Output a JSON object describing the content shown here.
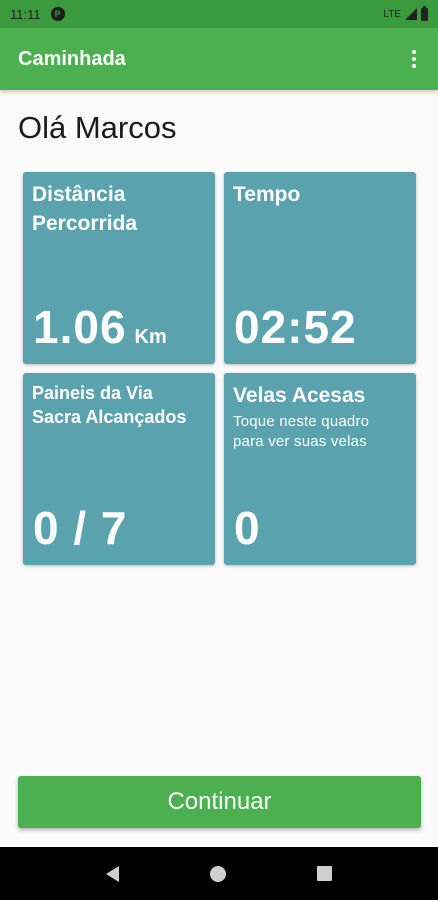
{
  "status_bar": {
    "time": "11:11",
    "app_icon_letter": "P",
    "network": "LTE"
  },
  "app_bar": {
    "title": "Caminhada"
  },
  "greeting": "Olá Marcos",
  "tiles": {
    "distance": {
      "title_line1": "Distância",
      "title_line2": "Percorrida",
      "value": "1.06",
      "unit": "Km"
    },
    "time": {
      "title": "Tempo",
      "value": "02:52"
    },
    "panels": {
      "title_line1": "Paineis da Via",
      "title_line2": "Sacra Alcançados",
      "value": "0 / 7"
    },
    "candles": {
      "title": "Velas Acesas",
      "subtitle_line1": "Toque neste quadro",
      "subtitle_line2": "para ver suas velas",
      "value": "0"
    }
  },
  "continue_button": {
    "label": "Continuar"
  },
  "colors": {
    "primary": "#4caf50",
    "status_bar": "#3a9a3e",
    "tile": "#5aa3ae"
  }
}
